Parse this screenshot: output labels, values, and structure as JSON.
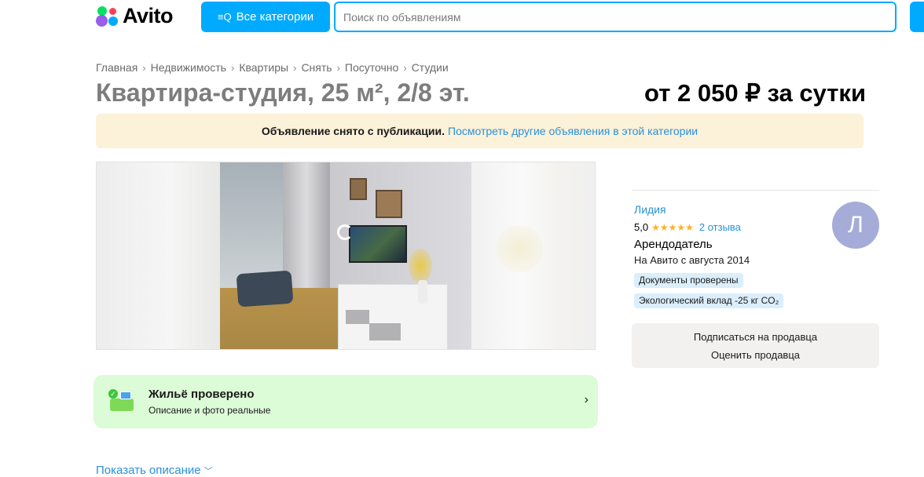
{
  "header": {
    "logo_text": "Avito",
    "categories_button": "Все категории",
    "categories_icon": "≡Q",
    "search_placeholder": "Поиск по объявлениям"
  },
  "breadcrumbs": [
    "Главная",
    "Недвижимость",
    "Квартиры",
    "Снять",
    "Посуточно",
    "Студии"
  ],
  "listing": {
    "title": "Квартира-студия, 25 м², 2/8 эт.",
    "price": "от 2 050 ₽ за сутки"
  },
  "notice": {
    "bold_text": "Объявление снято с публикации.",
    "link_text": "Посмотреть другие объявления в этой категории"
  },
  "seller": {
    "name": "Лидия",
    "rating": "5,0",
    "stars": "★★★★★",
    "reviews": "2 отзыва",
    "role": "Арендодатель",
    "since": "На Авито с августа 2014",
    "badges": [
      "Документы проверены",
      "Экологический вклад -25 кг CO₂"
    ],
    "avatar_letter": "Л",
    "actions": {
      "subscribe": "Подписаться на продавца",
      "rate": "Оценить продавца"
    }
  },
  "verified": {
    "title": "Жильё проверено",
    "subtitle": "Описание и фото реальные",
    "chevron": "›"
  },
  "show_description": "Показать описание",
  "colors": {
    "accent": "#00aaff",
    "link": "#2a91d8",
    "notice_bg": "#fcf1d9",
    "verified_bg": "#dcfbd7",
    "badge_bg": "#dbeefc",
    "avatar_bg": "#a5acd8"
  }
}
